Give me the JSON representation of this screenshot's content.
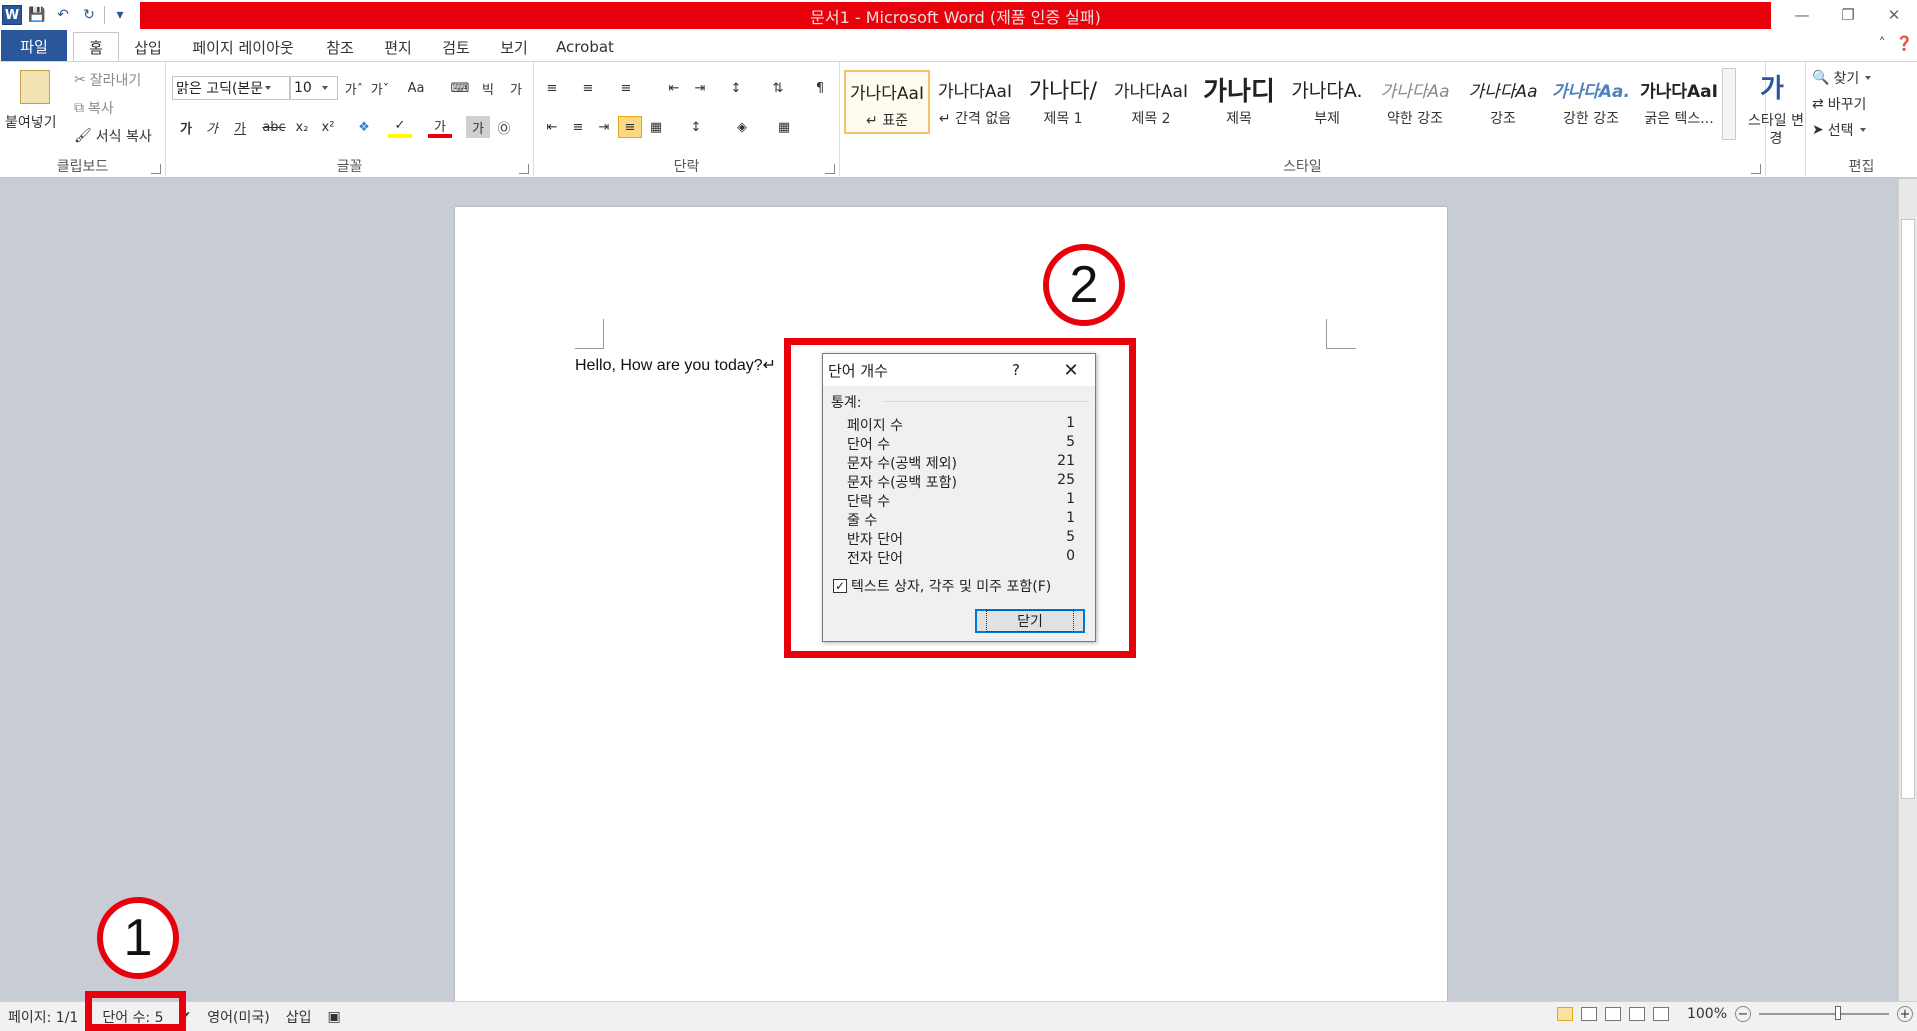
{
  "window": {
    "title": "문서1 - Microsoft Word (제품 인증 실패)",
    "app_icon": "W"
  },
  "ribbon_tabs": [
    {
      "label": "파일"
    },
    {
      "label": "홈"
    },
    {
      "label": "삽입"
    },
    {
      "label": "페이지 레이아웃"
    },
    {
      "label": "참조"
    },
    {
      "label": "편지"
    },
    {
      "label": "검토"
    },
    {
      "label": "보기"
    },
    {
      "label": "Acrobat"
    }
  ],
  "clipboard": {
    "paste": "붙여넣기",
    "cut": "잘라내기",
    "copy": "복사",
    "format_painter": "서식 복사",
    "group_label": "클립보드"
  },
  "font": {
    "family": "맑은 고딕(본문",
    "size": "10",
    "group_label": "글꼴"
  },
  "paragraph": {
    "group_label": "단락"
  },
  "styles": {
    "items": [
      {
        "sample": "가나다AaI",
        "name": "↵ 표준"
      },
      {
        "sample": "가나다AaI",
        "name": "↵ 간격 없음"
      },
      {
        "sample": "가나다/",
        "name": "제목 1"
      },
      {
        "sample": "가나다AaI",
        "name": "제목 2"
      },
      {
        "sample": "가나디",
        "name": "제목"
      },
      {
        "sample": "가나다A.",
        "name": "부제"
      },
      {
        "sample": "가나다Aa",
        "name": "약한 강조"
      },
      {
        "sample": "가나다Aa",
        "name": "강조"
      },
      {
        "sample": "가나다Aa.",
        "name": "강한 강조"
      },
      {
        "sample": "가나다AaI",
        "name": "굵은 텍스..."
      }
    ],
    "change_styles": "스타일 변경",
    "change_icon_text": "가",
    "group_label": "스타일"
  },
  "editing": {
    "find": "찾기",
    "replace": "바꾸기",
    "select": "선택",
    "group_label": "편집"
  },
  "document": {
    "text": "Hello, How are you today?↵"
  },
  "dialog": {
    "title": "단어 개수",
    "help": "?",
    "close": "✕",
    "stats_label": "통계:",
    "stats": [
      {
        "label": "페이지 수",
        "value": "1"
      },
      {
        "label": "단어 수",
        "value": "5"
      },
      {
        "label": "문자 수(공백 제외)",
        "value": "21"
      },
      {
        "label": "문자 수(공백 포함)",
        "value": "25"
      },
      {
        "label": "단락 수",
        "value": "1"
      },
      {
        "label": "줄 수",
        "value": "1"
      },
      {
        "label": "반자 단어",
        "value": "5"
      },
      {
        "label": "전자 단어",
        "value": "0"
      }
    ],
    "checkbox_label": "텍스트 상자, 각주 및 미주 포함(F)",
    "checkbox_checked": true,
    "close_button": "닫기"
  },
  "annotations": {
    "marker1": "1",
    "marker2": "2",
    "color": "#e8000b"
  },
  "statusbar": {
    "page": "페이지: 1/1",
    "words": "단어 수: 5",
    "language": "영어(미국)",
    "mode": "삽입",
    "zoom": "100%",
    "zoom_minus": "−",
    "zoom_plus": "+"
  },
  "colors": {
    "word_blue": "#2b579a",
    "title_bar_red": "#e8000b"
  }
}
